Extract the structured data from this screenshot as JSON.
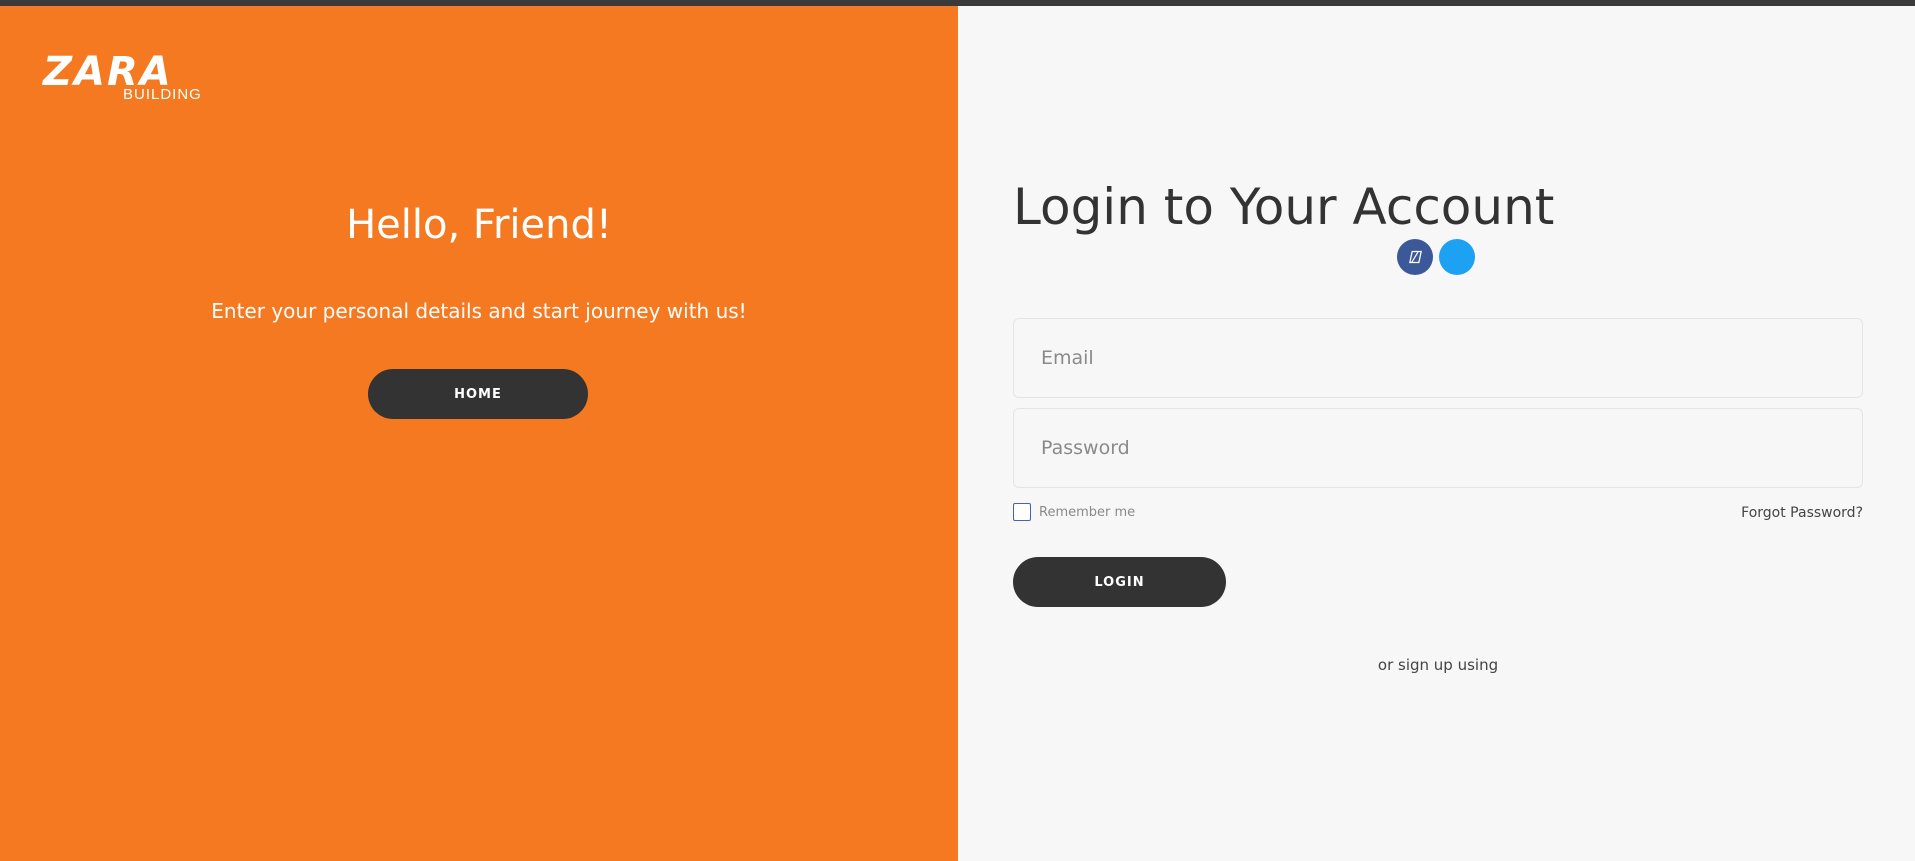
{
  "brand": {
    "logo_main": "ZARA",
    "logo_sub": "BUILDING",
    "primary_color": "#f47920",
    "dark_color": "#333333"
  },
  "left_panel": {
    "heading": "Hello, Friend!",
    "subtitle": "Enter your personal details and start journey with us!",
    "home_button": "HOME"
  },
  "login": {
    "title": "Login to Your Account",
    "social": [
      {
        "name": "facebook-icon",
        "color": "#3b5998"
      },
      {
        "name": "twitter-icon",
        "color": "#1da1f2"
      }
    ],
    "email_placeholder": "Email",
    "password_placeholder": "Password",
    "remember_label": "Remember me",
    "forgot_label": "Forgot Password?",
    "login_button": "LOGIN",
    "or_sign_up": "or sign up using"
  }
}
